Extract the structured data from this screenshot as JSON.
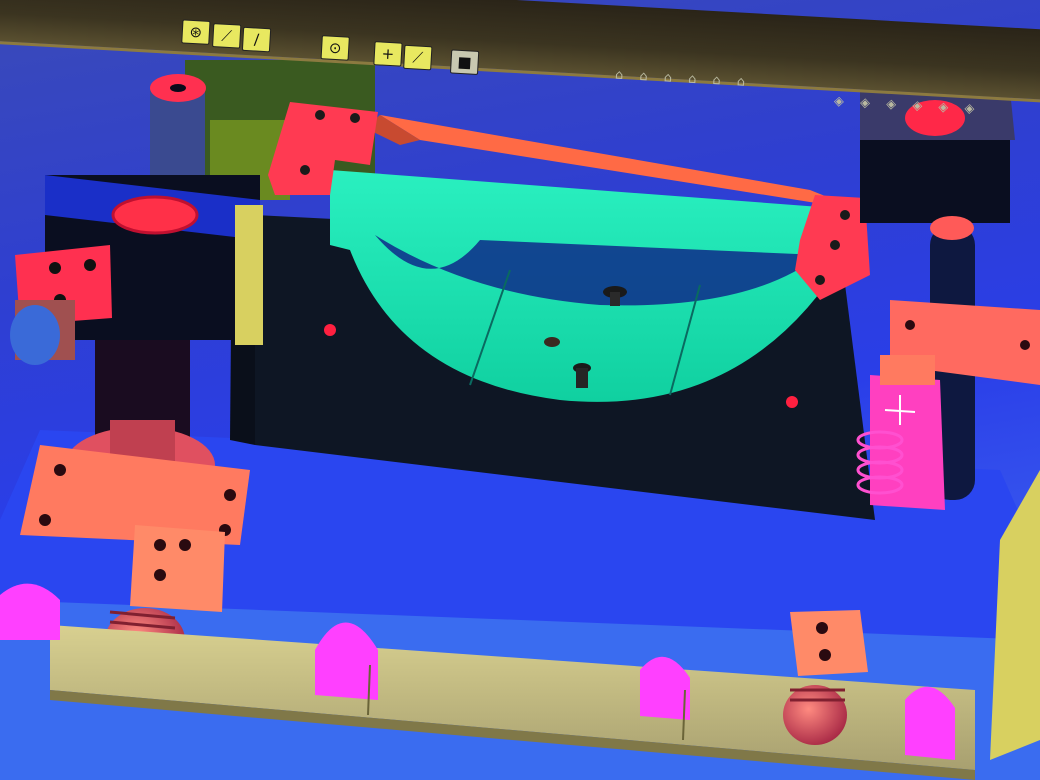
{
  "window": {
    "type": "cad-3d-viewport"
  },
  "toolbar": {
    "buttons": [
      {
        "name": "select-filter-button",
        "icon": "target-icon"
      },
      {
        "name": "line-tool-button",
        "icon": "line-icon"
      },
      {
        "name": "arc-tool-button",
        "icon": "slash-icon"
      },
      {
        "name": "point-tool-button",
        "icon": "circle-dot-icon"
      },
      {
        "name": "plus-tool-button",
        "icon": "plus-icon"
      },
      {
        "name": "segment-tool-button",
        "icon": "line-icon"
      },
      {
        "name": "solid-view-button",
        "icon": "cube-icon"
      }
    ]
  },
  "colors": {
    "background_blue": "#2a3ee8",
    "fixture_base": "#101828",
    "cradle_cyan": "#1ef0b0",
    "clamp_red": "#ff3050",
    "block_orange": "#ff7050",
    "spring_magenta": "#ff40d0",
    "rail_khaki": "#c8c080",
    "cutout_pink": "#ff40ff",
    "toolbar_yellow": "#e8e860"
  }
}
